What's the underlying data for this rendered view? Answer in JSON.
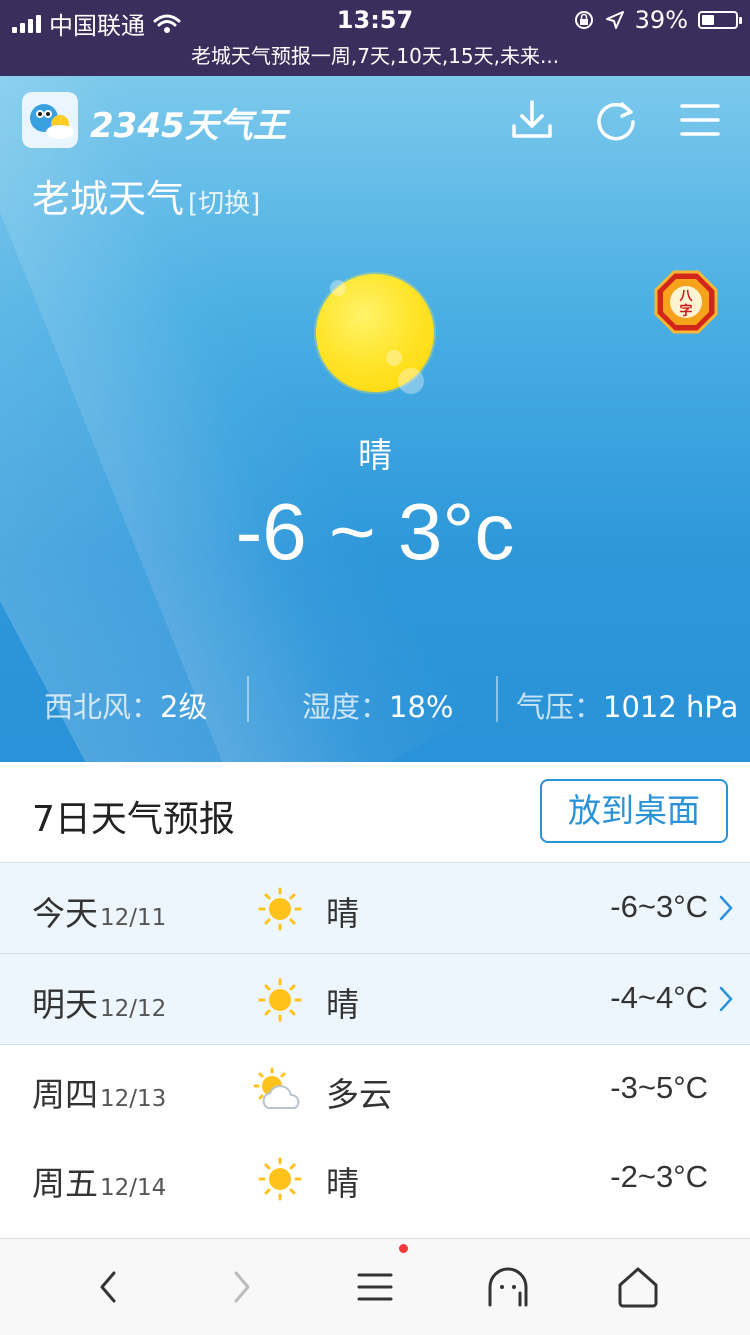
{
  "status_bar": {
    "carrier": "中国联通",
    "time": "13:57",
    "battery": "39%",
    "battery_level": 0.39,
    "page_title": "老城天气预报一周,7天,10天,15天,未来..."
  },
  "header": {
    "logo_text": "2345天气王",
    "icons": [
      "download-icon",
      "refresh-icon",
      "menu-icon"
    ]
  },
  "city": {
    "name": "老城天气",
    "switch_label": "[切换]"
  },
  "current": {
    "condition": "晴",
    "temp_range": "-6 ~ 3°c",
    "badge": "八字"
  },
  "stats": [
    {
      "label": "西北风：",
      "value": "2级"
    },
    {
      "label": "湿度：",
      "value": "18%"
    },
    {
      "label": "气压：",
      "value": "1012 hPa"
    }
  ],
  "forecast": {
    "title": "7日天气预报",
    "button": "放到桌面",
    "days": [
      {
        "day": "今天",
        "date": "12/11",
        "icon": "sunny-icon",
        "condition": "晴",
        "temp": "-6~3°C",
        "highlight": true
      },
      {
        "day": "明天",
        "date": "12/12",
        "icon": "sunny-icon",
        "condition": "晴",
        "temp": "-4~4°C",
        "highlight": true
      },
      {
        "day": "周四",
        "date": "12/13",
        "icon": "partly-cloudy-icon",
        "condition": "多云",
        "temp": "-3~5°C",
        "highlight": false
      },
      {
        "day": "周五",
        "date": "12/14",
        "icon": "sunny-icon",
        "condition": "晴",
        "temp": "-2~3°C",
        "highlight": false
      }
    ]
  },
  "bottom_nav": [
    "back-icon",
    "forward-icon",
    "menu-icon",
    "ghost-icon",
    "home-icon"
  ],
  "colors": {
    "status_bar_bg": "#3a2f5c",
    "sky_blue": "#2d97da",
    "accent": "#2a93d8",
    "highlight_row": "#eef6fd",
    "sun_yellow": "#ffd400",
    "notify_red": "#f23a3a"
  }
}
